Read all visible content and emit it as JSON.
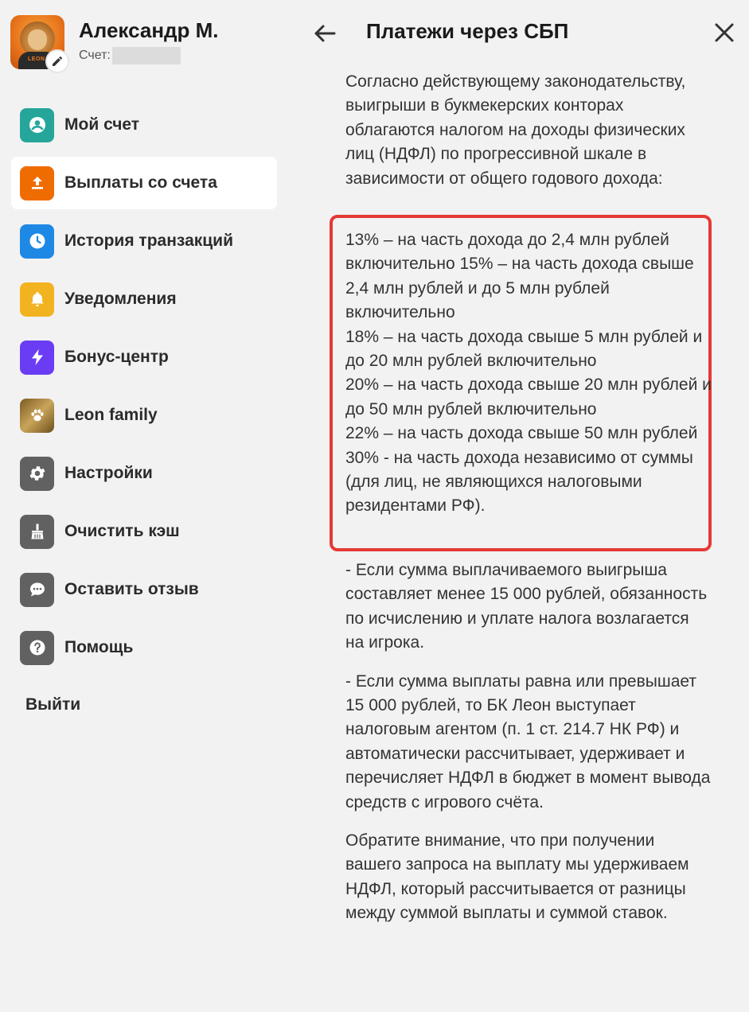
{
  "profile": {
    "name": "Александр М.",
    "account_label": "Счет:",
    "avatar_text": "LEON"
  },
  "menu": {
    "items": [
      {
        "label": "Мой счет",
        "icon": "user-circle-icon",
        "color": "#26a69a"
      },
      {
        "label": "Выплаты со счета",
        "icon": "upload-icon",
        "color": "#ef6c00",
        "active": true
      },
      {
        "label": "История транзакций",
        "icon": "clock-icon",
        "color": "#1e88e5"
      },
      {
        "label": "Уведомления",
        "icon": "bell-icon",
        "color": "#f2b320"
      },
      {
        "label": "Бонус-центр",
        "icon": "lightning-icon",
        "color": "#6a3df5"
      },
      {
        "label": "Leon family",
        "icon": "paw-icon",
        "color": "#9a7b3c"
      },
      {
        "label": "Настройки",
        "icon": "gear-icon",
        "color": "#616161"
      },
      {
        "label": "Очистить кэш",
        "icon": "broom-icon",
        "color": "#616161"
      },
      {
        "label": "Оставить отзыв",
        "icon": "chat-bubble-icon",
        "color": "#616161"
      },
      {
        "label": "Помощь",
        "icon": "help-icon",
        "color": "#616161"
      }
    ],
    "logout": "Выйти"
  },
  "header": {
    "title": "Платежи через СБП"
  },
  "content": {
    "intro": "Согласно действующему законодательству, выигрыши в букмекерских конторах облагаются налогом на доходы физических лиц (НДФЛ) по прогрессивной шкале в зависимости от общего годового дохода:",
    "rates": [
      "13% – на часть дохода до 2,4 млн рублей включительно 15% – на часть дохода свыше 2,4 млн рублей и до 5 млн рублей включительно",
      "18% – на часть дохода свыше 5 млн рублей и до 20 млн рублей включительно",
      "20% – на часть дохода свыше 20 млн рублей и до 50 млн рублей включительно",
      "22% – на часть дохода свыше 50 млн рублей",
      "30% - на часть дохода независимо от суммы (для лиц, не являющихся налоговыми резидентами РФ)."
    ],
    "note1": "- Если сумма выплачиваемого выигрыша составляет менее 15 000 рублей, обязанность по исчислению и уплате налога возлагается на игрока.",
    "note2": "- Если сумма выплаты равна или превышает 15 000 рублей, то БК Леон выступает налоговым агентом (п. 1 ст. 214.7 НК РФ) и автоматически рассчитывает, удерживает и перечисляет НДФЛ в бюджет в момент вывода средств с игрового счёта.",
    "note3": "Обратите внимание, что при получении вашего запроса на выплату мы удерживаем НДФЛ, который рассчитывается от разницы между суммой выплаты и суммой ставок."
  },
  "colors": {
    "highlight_border": "#e53935",
    "background": "#f2f2f2",
    "active_item_bg": "#ffffff"
  }
}
